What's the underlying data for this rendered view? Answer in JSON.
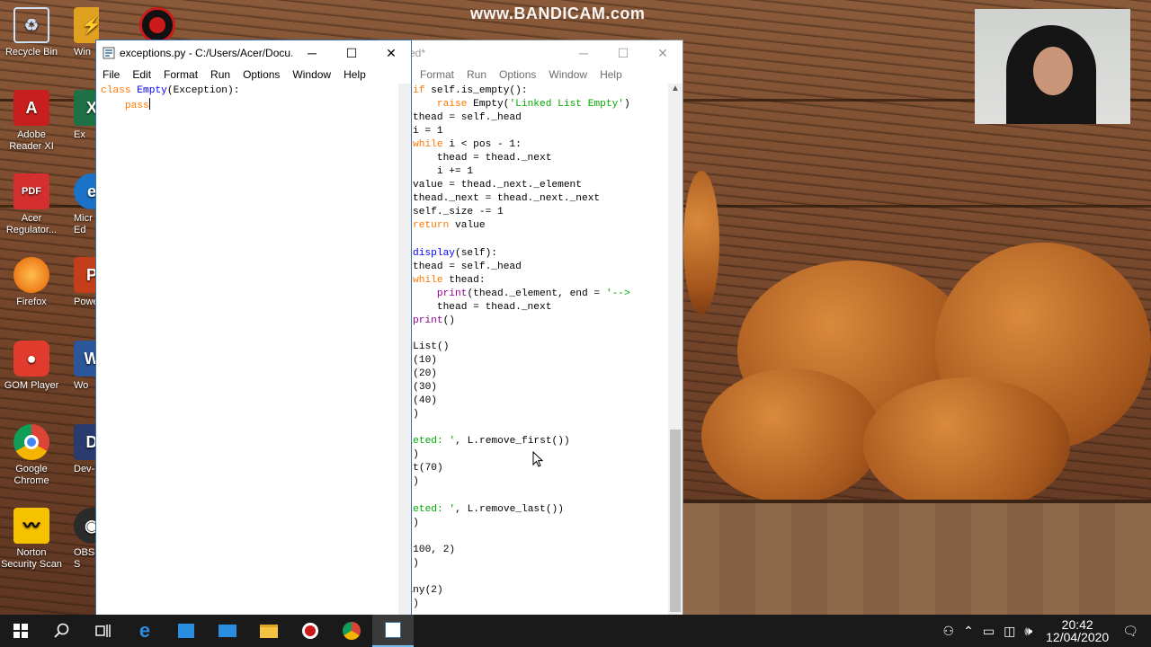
{
  "watermark": "www.BANDICAM.com",
  "desktop_icons": [
    {
      "id": "recycle",
      "label": "Recycle Bin",
      "icon": "recycle-bin-icon",
      "color": "#5b8fc9"
    },
    {
      "id": "winamp",
      "label": "Win",
      "icon": "winamp-icon",
      "color": "#e0a020"
    },
    {
      "id": "bandicam",
      "label": "",
      "icon": "bandicam-icon",
      "color": "#cc1a1a"
    },
    {
      "id": "adobe",
      "label": "Adobe Reader XI",
      "icon": "adobe-reader-icon",
      "color": "#c81e1e"
    },
    {
      "id": "excel",
      "label": "Ex",
      "icon": "excel-icon",
      "color": "#1e7145"
    },
    {
      "id": "acer",
      "label": "Acer Regulator...",
      "icon": "pdf-icon",
      "color": "#d32f2f"
    },
    {
      "id": "edge",
      "label": "Micr Ed",
      "icon": "edge-icon",
      "color": "#1a73c9"
    },
    {
      "id": "firefox",
      "label": "Firefox",
      "icon": "firefox-icon",
      "color": "#e66000"
    },
    {
      "id": "ppt",
      "label": "Powe",
      "icon": "powerpoint-icon",
      "color": "#c43e1c"
    },
    {
      "id": "gom",
      "label": "GOM Player",
      "icon": "gom-player-icon",
      "color": "#e03b2c"
    },
    {
      "id": "word",
      "label": "Wo",
      "icon": "word-icon",
      "color": "#2b579a"
    },
    {
      "id": "chrome",
      "label": "Google Chrome",
      "icon": "chrome-icon",
      "color": "#dd4b39"
    },
    {
      "id": "devc",
      "label": "Dev-",
      "icon": "dev-cpp-icon",
      "color": "#2a3b6e"
    },
    {
      "id": "norton",
      "label": "Norton Security Scan",
      "icon": "norton-icon",
      "color": "#f6c200"
    },
    {
      "id": "obs",
      "label": "OBS S",
      "icon": "obs-icon",
      "color": "#2b2b2b"
    }
  ],
  "left_window": {
    "title": "exceptions.py - C:/Users/Acer/Docu...",
    "menu": [
      "File",
      "Edit",
      "Format",
      "Run",
      "Options",
      "Window",
      "Help"
    ],
    "code_line1_kw": "class",
    "code_line1_name": "Empty",
    "code_line1_paren": "(Exception):",
    "code_line2": "pass"
  },
  "right_window": {
    "title": "ed*",
    "menu": [
      "Format",
      "Run",
      "Options",
      "Window",
      "Help"
    ]
  },
  "taskbar": {
    "time": "20:42",
    "date": "12/04/2020"
  }
}
